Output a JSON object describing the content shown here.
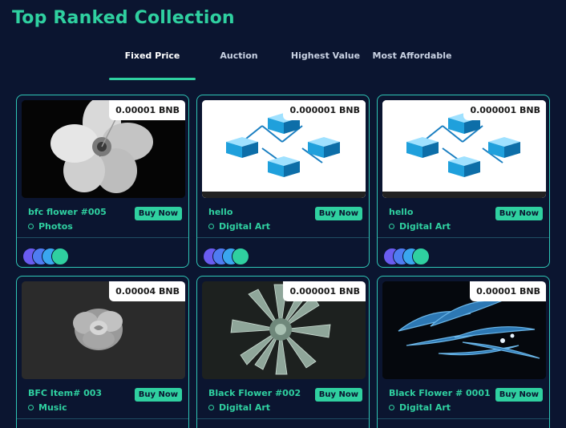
{
  "header": {
    "title": "Top Ranked Collection"
  },
  "tabs": [
    {
      "label": "Fixed Price",
      "active": true
    },
    {
      "label": "Auction",
      "active": false
    },
    {
      "label": "Highest Value",
      "active": false
    },
    {
      "label": "Most Affordable",
      "active": false
    }
  ],
  "cards": [
    {
      "price": "0.00001 BNB",
      "name": "bfc flower #005",
      "category": "Photos",
      "buy_label": "Buy Now",
      "image": "white-hibiscus-flower"
    },
    {
      "price": "0.000001 BNB",
      "name": "hello",
      "category": "Digital Art",
      "buy_label": "Buy Now",
      "image": "blockchain-cubes"
    },
    {
      "price": "0.000001 BNB",
      "name": "hello",
      "category": "Digital Art",
      "buy_label": "Buy Now",
      "image": "blockchain-cubes"
    },
    {
      "price": "0.00004 BNB",
      "name": "BFC Item# 003",
      "category": "Music",
      "buy_label": "Buy Now",
      "image": "grey-rose"
    },
    {
      "price": "0.000001 BNB",
      "name": "Black Flower #002",
      "category": "Digital Art",
      "buy_label": "Buy Now",
      "image": "agave-succulent"
    },
    {
      "price": "0.00001 BNB",
      "name": "Black Flower # 0001",
      "category": "Digital Art",
      "buy_label": "Buy Now",
      "image": "blue-lily"
    }
  ],
  "avatar_colors": [
    "#6a5cf0",
    "#4f7cf2",
    "#3aa6ef",
    "#2fd0a0"
  ],
  "colors": {
    "accent": "#2fd0a0",
    "background": "#0b1530",
    "border": "#2fc6b6"
  }
}
